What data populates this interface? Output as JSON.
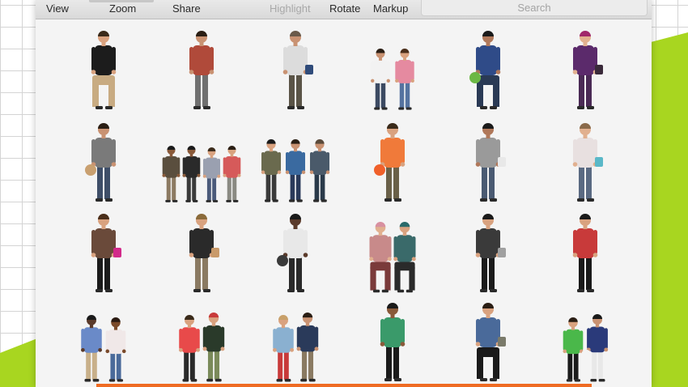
{
  "toolbar": {
    "view_label": "View",
    "zoom_label": "Zoom",
    "share_label": "Share",
    "highlight_label": "Highlight",
    "rotate_label": "Rotate",
    "markup_label": "Markup",
    "search_placeholder": "Search"
  },
  "colors": {
    "accent_green": "#a8d620",
    "progress_orange": "#ef6b23",
    "toolbar_disabled": "#a8a8a8"
  },
  "figures": [
    {
      "name": "seated-man-skull-shirt",
      "people": [
        {
          "top": "#1c1c1c",
          "bottom": "#c8ab82",
          "skin": "#d9a27f",
          "hair": "#3a2a1a",
          "pose": "sit"
        }
      ]
    },
    {
      "name": "man-red-shirt-photographing",
      "people": [
        {
          "top": "#b04a3a",
          "bottom": "#707070",
          "skin": "#c99272",
          "hair": "#2a1e14",
          "pose": "stand"
        }
      ]
    },
    {
      "name": "man-backpack-walking-away",
      "people": [
        {
          "top": "#dcdcdc",
          "bottom": "#5a5447",
          "skin": "#c99272",
          "hair": "#6a5a4a",
          "pose": "stand",
          "bag": "#2f4b7a"
        }
      ]
    },
    {
      "name": "couple-walking",
      "people": [
        {
          "top": "#f2f2f2",
          "bottom": "#3c4a62",
          "skin": "#c99272",
          "hair": "#2a1e14",
          "pose": "stand",
          "scale": 0.78
        },
        {
          "top": "#e58aa0",
          "bottom": "#5573a0",
          "skin": "#d9a27f",
          "hair": "#4a2e1a",
          "pose": "stand",
          "scale": 0.78
        }
      ]
    },
    {
      "name": "man-crouching-lettuce",
      "people": [
        {
          "top": "#2f4b88",
          "bottom": "#2a3a55",
          "skin": "#b0785a",
          "hair": "#1a1a1a",
          "pose": "crouch",
          "prop": "#6cb844"
        }
      ]
    },
    {
      "name": "woman-purple-hair",
      "people": [
        {
          "top": "#5b2a6b",
          "bottom": "#4a2a55",
          "skin": "#e1b08f",
          "hair": "#a0286a",
          "pose": "stand",
          "bag": "#3a2a3a"
        }
      ]
    },
    {
      "name": "man-carrying-boxes",
      "people": [
        {
          "top": "#7a7a7a",
          "bottom": "#3e4e68",
          "skin": "#c99272",
          "hair": "#2a1e14",
          "pose": "stand",
          "prop": "#c9a070"
        }
      ]
    },
    {
      "name": "group-of-four",
      "people": [
        {
          "top": "#5a4e3e",
          "bottom": "#8c7a62",
          "skin": "#8a5a3a",
          "hair": "#1a1a1a",
          "pose": "stand",
          "scale": 0.72
        },
        {
          "top": "#2a2a2a",
          "bottom": "#3a3a3a",
          "skin": "#8a5a3a",
          "hair": "#1a1a1a",
          "pose": "stand",
          "scale": 0.72
        },
        {
          "top": "#9aa0b0",
          "bottom": "#4a5a7a",
          "skin": "#d9a27f",
          "hair": "#3a2a1a",
          "pose": "stand",
          "scale": 0.7
        },
        {
          "top": "#d65a5a",
          "bottom": "#8a8a82",
          "skin": "#d9a27f",
          "hair": "#2a1e14",
          "pose": "stand",
          "scale": 0.72
        }
      ]
    },
    {
      "name": "group-of-three",
      "people": [
        {
          "top": "#6a6a4e",
          "bottom": "#3a3a3a",
          "skin": "#d9a27f",
          "hair": "#1a1a1a",
          "pose": "stand",
          "scale": 0.8
        },
        {
          "top": "#3a6aa0",
          "bottom": "#2a3a5a",
          "skin": "#c99272",
          "hair": "#2a1e14",
          "pose": "stand",
          "scale": 0.8
        },
        {
          "top": "#4a5a6a",
          "bottom": "#2a3a4a",
          "skin": "#c99272",
          "hair": "#5a4a3a",
          "pose": "stand",
          "scale": 0.8
        }
      ]
    },
    {
      "name": "kid-orange-balloon",
      "people": [
        {
          "top": "#f07a3a",
          "bottom": "#6a6048",
          "skin": "#d9a27f",
          "hair": "#3a2a1a",
          "pose": "stand",
          "prop": "#f0602a"
        }
      ]
    },
    {
      "name": "man-grey-shirt-walking",
      "people": [
        {
          "top": "#9a9a9a",
          "bottom": "#4a5a72",
          "skin": "#b0785a",
          "hair": "#1a1a1a",
          "pose": "stand",
          "bag": "#e8e8e8"
        }
      ]
    },
    {
      "name": "woman-shopping-bag",
      "people": [
        {
          "top": "#e8e0e0",
          "bottom": "#5a6a82",
          "skin": "#e1b08f",
          "hair": "#8a6a4a",
          "pose": "stand",
          "bag": "#5ab8c8"
        }
      ]
    },
    {
      "name": "woman-magenta-bag",
      "people": [
        {
          "top": "#6a4a3a",
          "bottom": "#1a1a1a",
          "skin": "#d9a27f",
          "hair": "#4a2e1a",
          "pose": "stand",
          "bag": "#d22a8a"
        }
      ]
    },
    {
      "name": "man-carrying-groceries",
      "people": [
        {
          "top": "#2a2a2a",
          "bottom": "#8a7a62",
          "skin": "#d9a27f",
          "hair": "#8a6a3a",
          "pose": "stand",
          "bag": "#c99a6a"
        }
      ]
    },
    {
      "name": "man-pushing-stroller",
      "people": [
        {
          "top": "#e8e8e8",
          "bottom": "#2a2a2a",
          "skin": "#5a3a2a",
          "hair": "#1a1a1a",
          "pose": "stand",
          "prop": "#3a3a3a"
        }
      ]
    },
    {
      "name": "two-seated-women",
      "people": [
        {
          "top": "#c88a8a",
          "bottom": "#7a3a3a",
          "skin": "#e1b08f",
          "hair": "#d890a0",
          "pose": "sit",
          "scale": 0.9
        },
        {
          "top": "#3a6a6a",
          "bottom": "#2a2a2a",
          "skin": "#d9a27f",
          "hair": "#2a6a6a",
          "pose": "sit",
          "scale": 0.9
        }
      ]
    },
    {
      "name": "woman-scarf-standing",
      "people": [
        {
          "top": "#3a3a3a",
          "bottom": "#1a1a1a",
          "skin": "#d9a27f",
          "hair": "#1a1a1a",
          "pose": "stand",
          "bag": "#a0a0a0"
        }
      ]
    },
    {
      "name": "boy-red-shirt",
      "people": [
        {
          "top": "#c83a3a",
          "bottom": "#1a1a1a",
          "skin": "#d9a27f",
          "hair": "#1a1a1a",
          "pose": "stand"
        }
      ]
    },
    {
      "name": "couple-walking-together",
      "people": [
        {
          "top": "#6a8ac8",
          "bottom": "#c8b08a",
          "skin": "#5a3a2a",
          "hair": "#1a1a1a",
          "pose": "stand",
          "scale": 0.85
        },
        {
          "top": "#f0e8e8",
          "bottom": "#4a6a9a",
          "skin": "#7a4a2a",
          "hair": "#2a1a12",
          "pose": "stand",
          "scale": 0.82
        }
      ]
    },
    {
      "name": "two-men-playing",
      "people": [
        {
          "top": "#e84a4a",
          "bottom": "#2a2a2a",
          "skin": "#d9a27f",
          "hair": "#3a2a1a",
          "pose": "stand",
          "scale": 0.85
        },
        {
          "top": "#2a3a2a",
          "bottom": "#7a8a5a",
          "skin": "#d9a27f",
          "hair": "#c83a3a",
          "pose": "stand",
          "scale": 0.88
        }
      ]
    },
    {
      "name": "couple-denim-jacket",
      "people": [
        {
          "top": "#8ab0d0",
          "bottom": "#c83a3a",
          "skin": "#d9a27f",
          "hair": "#c8a06a",
          "pose": "stand",
          "scale": 0.85
        },
        {
          "top": "#2a3a5a",
          "bottom": "#8a7a62",
          "skin": "#c99272",
          "hair": "#2a1e14",
          "pose": "stand",
          "scale": 0.88
        }
      ]
    },
    {
      "name": "woman-green-top",
      "people": [
        {
          "top": "#3a9a6a",
          "bottom": "#1a1a1a",
          "skin": "#8a5a3a",
          "hair": "#1a1a1a",
          "pose": "stand"
        }
      ]
    },
    {
      "name": "man-seated-with-bag",
      "people": [
        {
          "top": "#4a6a9a",
          "bottom": "#1a1a1a",
          "skin": "#d9a27f",
          "hair": "#2a1e14",
          "pose": "sit",
          "bag": "#7a7a6a"
        }
      ]
    },
    {
      "name": "boys-playing-soccer",
      "people": [
        {
          "top": "#4ab84a",
          "bottom": "#1a1a1a",
          "skin": "#d9a27f",
          "hair": "#2a1e14",
          "pose": "stand",
          "scale": 0.82
        },
        {
          "top": "#2a3a7a",
          "bottom": "#e8e8e8",
          "skin": "#c99272",
          "hair": "#1a1a1a",
          "pose": "stand",
          "scale": 0.86,
          "prop": "#f4f4f4"
        }
      ]
    }
  ]
}
